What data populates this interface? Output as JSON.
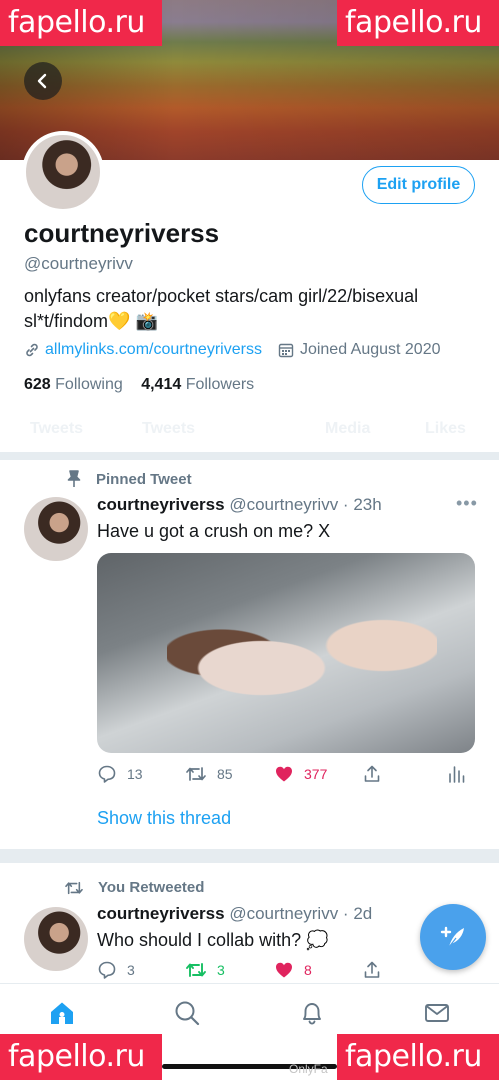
{
  "watermarks": {
    "top_left": "fapello.ru",
    "top_right": "fapello.ru",
    "bottom_left": "fapello.ru",
    "bottom_right": "fapello.ru"
  },
  "header": {
    "back_icon": "chevron-left-icon"
  },
  "profile": {
    "edit_profile_label": "Edit profile",
    "display_name": "courtneyriverss",
    "handle": "@courtneyrivv",
    "bio_line1": "onlyfans creator/pocket stars/cam girl/22/bisexual",
    "bio_line2": "sl*t/findom💛 📸",
    "link": "allmylinks.com/courtneyriverss",
    "joined": "Joined August 2020",
    "following_count": "628",
    "following_label": "Following",
    "followers_count": "4,414",
    "followers_label": "Followers"
  },
  "tabs_faint": [
    "Tweets",
    "Tweets",
    "Media",
    "Likes"
  ],
  "tweets": [
    {
      "context": "Pinned Tweet",
      "name": "courtneyriverss",
      "meta": "@courtneyrivv · 23h",
      "text": "Have u got a crush on me? X",
      "replies": "13",
      "retweets": "85",
      "likes": "377",
      "show_thread": "Show this thread"
    },
    {
      "context": "You Retweeted",
      "name": "courtneyriverss",
      "meta": "@courtneyrivv · 2d",
      "text": "Who should I collab with? 💭",
      "replies": "3",
      "retweets": "3",
      "likes": "8"
    }
  ],
  "footer_faint": "OnlyFa",
  "colors": {
    "accent": "#1da1f2",
    "like": "#e0245e",
    "retweet": "#17bf63",
    "watermark": "#f0284a"
  }
}
